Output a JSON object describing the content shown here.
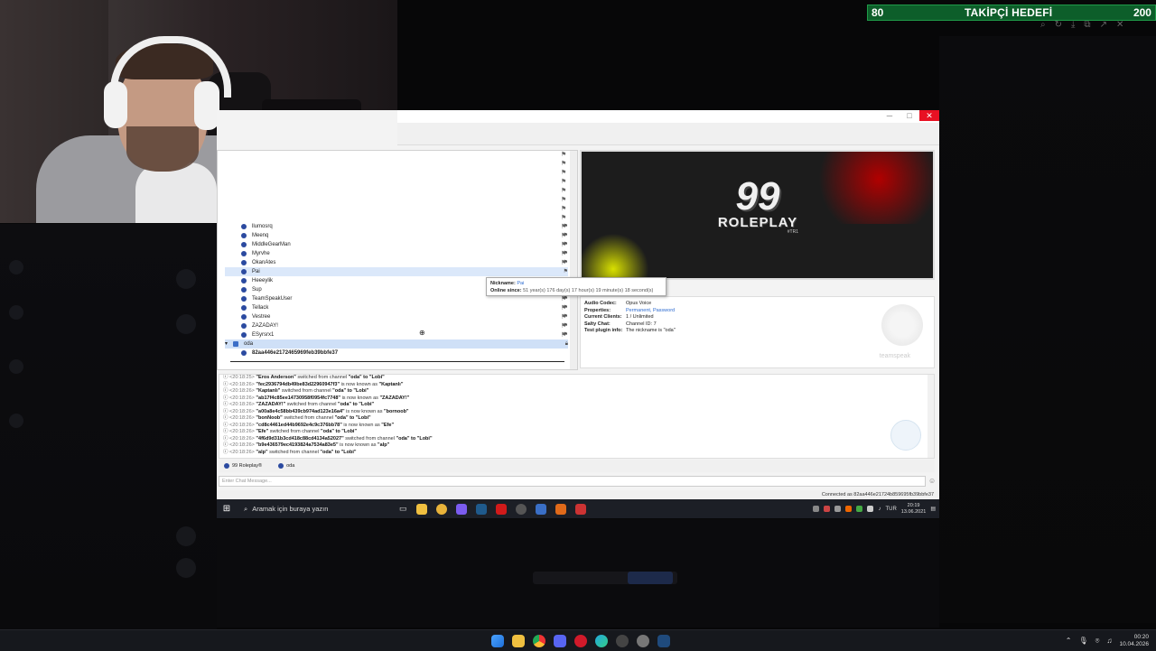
{
  "overlay": {
    "goal_current": "80",
    "goal_title": "TAKİPÇİ HEDEFİ",
    "goal_target": "200"
  },
  "remote_window": {
    "tree_users": [
      {
        "name": "llumosrq"
      },
      {
        "name": "Meenq"
      },
      {
        "name": "MiddleGearMan"
      },
      {
        "name": "Myrvhe"
      },
      {
        "name": "OkanAtes"
      },
      {
        "name": "Pai",
        "selected": true
      },
      {
        "name": "Heeeylik"
      },
      {
        "name": "Sup"
      },
      {
        "name": "TeamSpeakUser"
      },
      {
        "name": "Tellack"
      },
      {
        "name": "Vestree"
      },
      {
        "name": "ZAZADAY!"
      },
      {
        "name": "ESyrsrx1"
      }
    ],
    "channel_name": "oda",
    "channel_user": "82aa446e2172465969feb39bbfe37",
    "tooltip": {
      "nickname_label": "Nickname:",
      "nickname_value": "Pai",
      "online_label": "Online since:",
      "online_value": "51 year(s) 176 day(s) 17 hour(s) 19 minute(s) 18 second(s)"
    },
    "banner": {
      "number": "99",
      "title": "ROLEPLAY",
      "tag": "#TR1"
    },
    "info": [
      {
        "label": "Audio Codec:",
        "value": "Opus Voice"
      },
      {
        "label": "Properties:",
        "value": "Permanent, Password",
        "link": true
      },
      {
        "label": "Current Clients:",
        "value": "1 / Unlimited"
      },
      {
        "label": "Salty Chat:",
        "value": "Channel ID: 7"
      },
      {
        "label": "Test plugin info:",
        "value": "The nickname is \"oda\""
      }
    ],
    "ts_logo_text": "teamspeak",
    "log": [
      {
        "time": "<20:18:25>",
        "name": "\"Eros Anderson\"",
        "text": "switched from channel",
        "extra": "\"oda\" to \"Lobi\""
      },
      {
        "time": "<20:18:26>",
        "name": "\"fec2936794db49be83d22960947f3\"",
        "text": "is now known as",
        "extra": "\"Kaptanlı\""
      },
      {
        "time": "<20:18:26>",
        "name": "\"Kaptanlı\"",
        "text": "switched from channel",
        "extra": "\"oda\" to \"Lobi\""
      },
      {
        "time": "<20:18:26>",
        "name": "\"ab17f4c85ee14730958f0954fc7748\"",
        "text": "is now known as",
        "extra": "\"ZAZADAY!\""
      },
      {
        "time": "<20:18:26>",
        "name": "\"ZAZADAY!\"",
        "text": "switched from channel",
        "extra": "\"oda\" to \"Lobi\""
      },
      {
        "time": "<20:18:26>",
        "name": "\"a00a8e4c58bb439cb974ad123e16a4\"",
        "text": "is now known as",
        "extra": "\"bornoob\""
      },
      {
        "time": "<20:18:26>",
        "name": "\"bonNoob\"",
        "text": "switched from channel",
        "extra": "\"oda\" to \"Lobi\""
      },
      {
        "time": "<20:18:26>",
        "name": "\"cd8c4461ed44b9692e4c9c376bb78\"",
        "text": "is now known as",
        "extra": "\"Efe\""
      },
      {
        "time": "<20:18:26>",
        "name": "\"Efe\"",
        "text": "switched from channel",
        "extra": "\"oda\" to \"Lobi\""
      },
      {
        "time": "<20:18:26>",
        "name": "\"4f6d9d31b3cd418c88cd4134a52027\"",
        "text": "switched from channel",
        "extra": "\"oda\" to \"Lobi\""
      },
      {
        "time": "<20:18:26>",
        "name": "\"b9e436579ec4193824a7534a83e5\"",
        "text": "is now known as",
        "extra": "\"alp\""
      },
      {
        "time": "<20:18:26>",
        "name": "\"alp\"",
        "text": "switched from channel",
        "extra": "\"oda\" to \"Lobi\""
      }
    ],
    "tabs": [
      "99 Roleplay®",
      "oda"
    ],
    "chat_placeholder": "Enter Chat Message...",
    "status_text": "Connected as 82aa446e21724b859695fb39bbfe37",
    "taskbar": {
      "search_text": "Aramak için buraya yazın",
      "lang": "TUR",
      "time": "20:19",
      "date": "13.06.2021"
    }
  },
  "host_taskbar": {
    "time": "00:20",
    "date": "10.04.2026"
  }
}
